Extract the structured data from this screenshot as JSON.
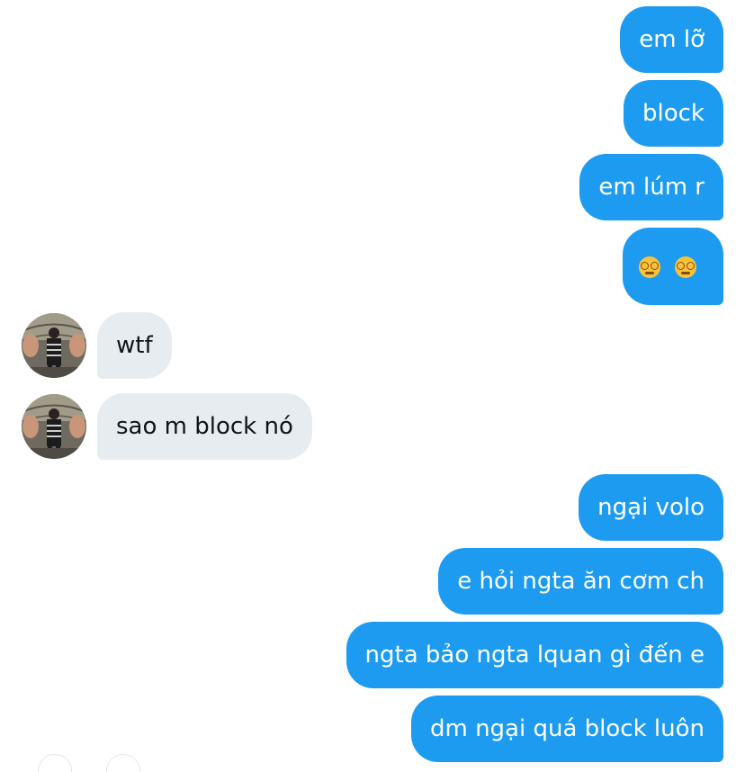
{
  "colors": {
    "outgoing_bubble": "#1d9bf0",
    "incoming_bubble": "#e7ecf0",
    "outgoing_text": "#ffffff",
    "incoming_text": "#0f1419"
  },
  "messages": [
    {
      "direction": "out",
      "text": "em lỡ"
    },
    {
      "direction": "out",
      "text": "block"
    },
    {
      "direction": "out",
      "text": "em lúm r"
    },
    {
      "direction": "out",
      "text": "",
      "emoji": [
        "dizzy-face-icon",
        "dizzy-face-icon"
      ]
    },
    {
      "direction": "in",
      "text": "wtf"
    },
    {
      "direction": "in",
      "text": "sao m block nó"
    },
    {
      "direction": "out",
      "text": "ngại volo"
    },
    {
      "direction": "out",
      "text": "e hỏi ngta ăn cơm ch"
    },
    {
      "direction": "out",
      "text": "ngta bảo ngta lquan gì đến e"
    },
    {
      "direction": "out",
      "text": "dm ngại quá block luôn"
    }
  ]
}
